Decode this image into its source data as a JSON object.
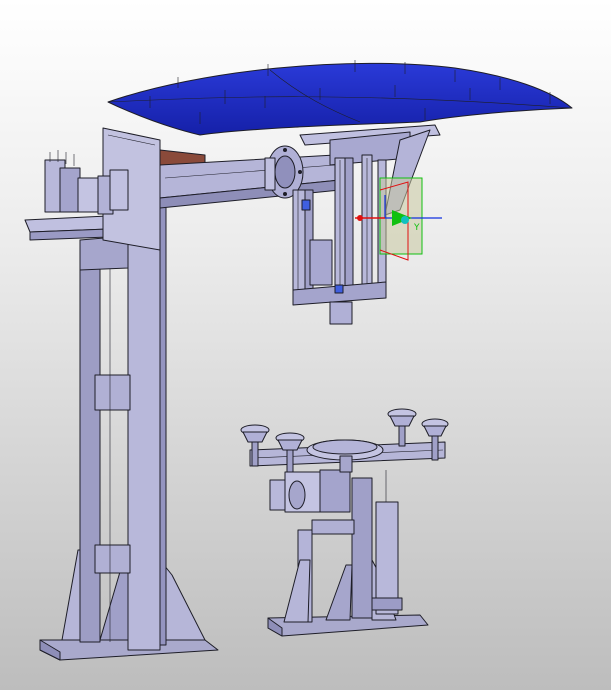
{
  "viewport": {
    "background_top": "#ffffff",
    "background_bottom": "#bdbdbd"
  },
  "model": {
    "part_color": "#b6b6d8",
    "part_shade": "#8e8eb8",
    "panel_color": "#1c2bc8",
    "bracket_color": "#8a4a3a",
    "edge_color": "#1e1e28"
  },
  "triad": {
    "x_axis_color": "#e01010",
    "y_axis_color": "#10c010",
    "z_axis_color": "#1030e0",
    "axis_label_y": "Y"
  }
}
